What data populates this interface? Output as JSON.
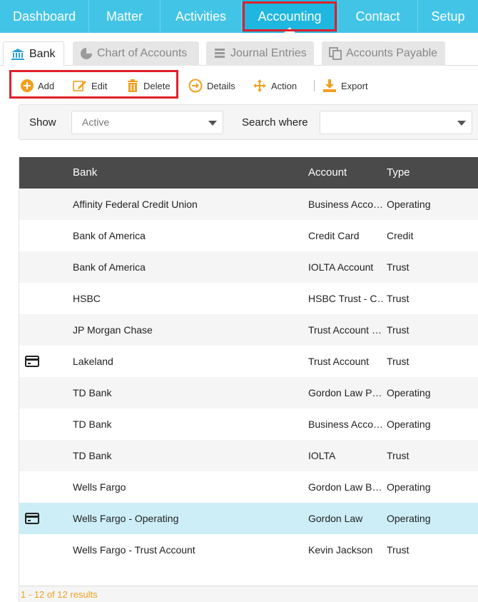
{
  "nav": {
    "items": [
      {
        "label": "Dashboard"
      },
      {
        "label": "Matter"
      },
      {
        "label": "Activities"
      },
      {
        "label": "Accounting"
      },
      {
        "label": "Contact"
      },
      {
        "label": "Setup"
      }
    ],
    "active": "Accounting"
  },
  "subtabs": [
    {
      "label": "Bank",
      "icon": "bank-icon"
    },
    {
      "label": "Chart of Accounts",
      "icon": "pie-chart-icon"
    },
    {
      "label": "Journal Entries",
      "icon": "stack-icon"
    },
    {
      "label": "Accounts Payable",
      "icon": "copy-icon"
    }
  ],
  "toolbar": {
    "add": "Add",
    "edit": "Edit",
    "delete": "Delete",
    "details": "Details",
    "action": "Action",
    "export": "Export"
  },
  "filter": {
    "show_label": "Show",
    "show_value": "Active",
    "search_label": "Search where",
    "search_value": ""
  },
  "grid": {
    "headers": {
      "bank": "Bank",
      "account": "Account",
      "type": "Type"
    },
    "rows": [
      {
        "bank": "Affinity Federal Credit Union",
        "account": "Business Acco…",
        "type": "Operating"
      },
      {
        "bank": "Bank of America",
        "account": "Credit Card",
        "type": "Credit"
      },
      {
        "bank": "Bank of America",
        "account": "IOLTA Account",
        "type": "Trust"
      },
      {
        "bank": "HSBC",
        "account": "HSBC Trust - C…",
        "type": "Trust"
      },
      {
        "bank": "JP Morgan Chase",
        "account": "Trust Account …",
        "type": "Trust"
      },
      {
        "bank": "Lakeland",
        "account": "Trust Account",
        "type": "Trust",
        "card_icon": true
      },
      {
        "bank": "TD Bank",
        "account": "Gordon Law P…",
        "type": "Operating"
      },
      {
        "bank": "TD Bank",
        "account": "Business Acco…",
        "type": "Operating"
      },
      {
        "bank": "TD Bank",
        "account": "IOLTA",
        "type": "Trust"
      },
      {
        "bank": "Wells Fargo",
        "account": "Gordon Law B…",
        "type": "Operating"
      },
      {
        "bank": "Wells Fargo - Operating",
        "account": "Gordon Law",
        "type": "Operating",
        "card_icon": true,
        "selected": true
      },
      {
        "bank": "Wells Fargo - Trust Account",
        "account": "Kevin Jackson",
        "type": "Trust"
      }
    ],
    "footer": "1 - 12 of 12 results"
  },
  "colors": {
    "nav_bg": "#42c4e6",
    "nav_active": "#1fb6e0",
    "accent_orange": "#f0a020",
    "highlight_red": "#e0202a",
    "selected_row": "#cdeef7"
  }
}
